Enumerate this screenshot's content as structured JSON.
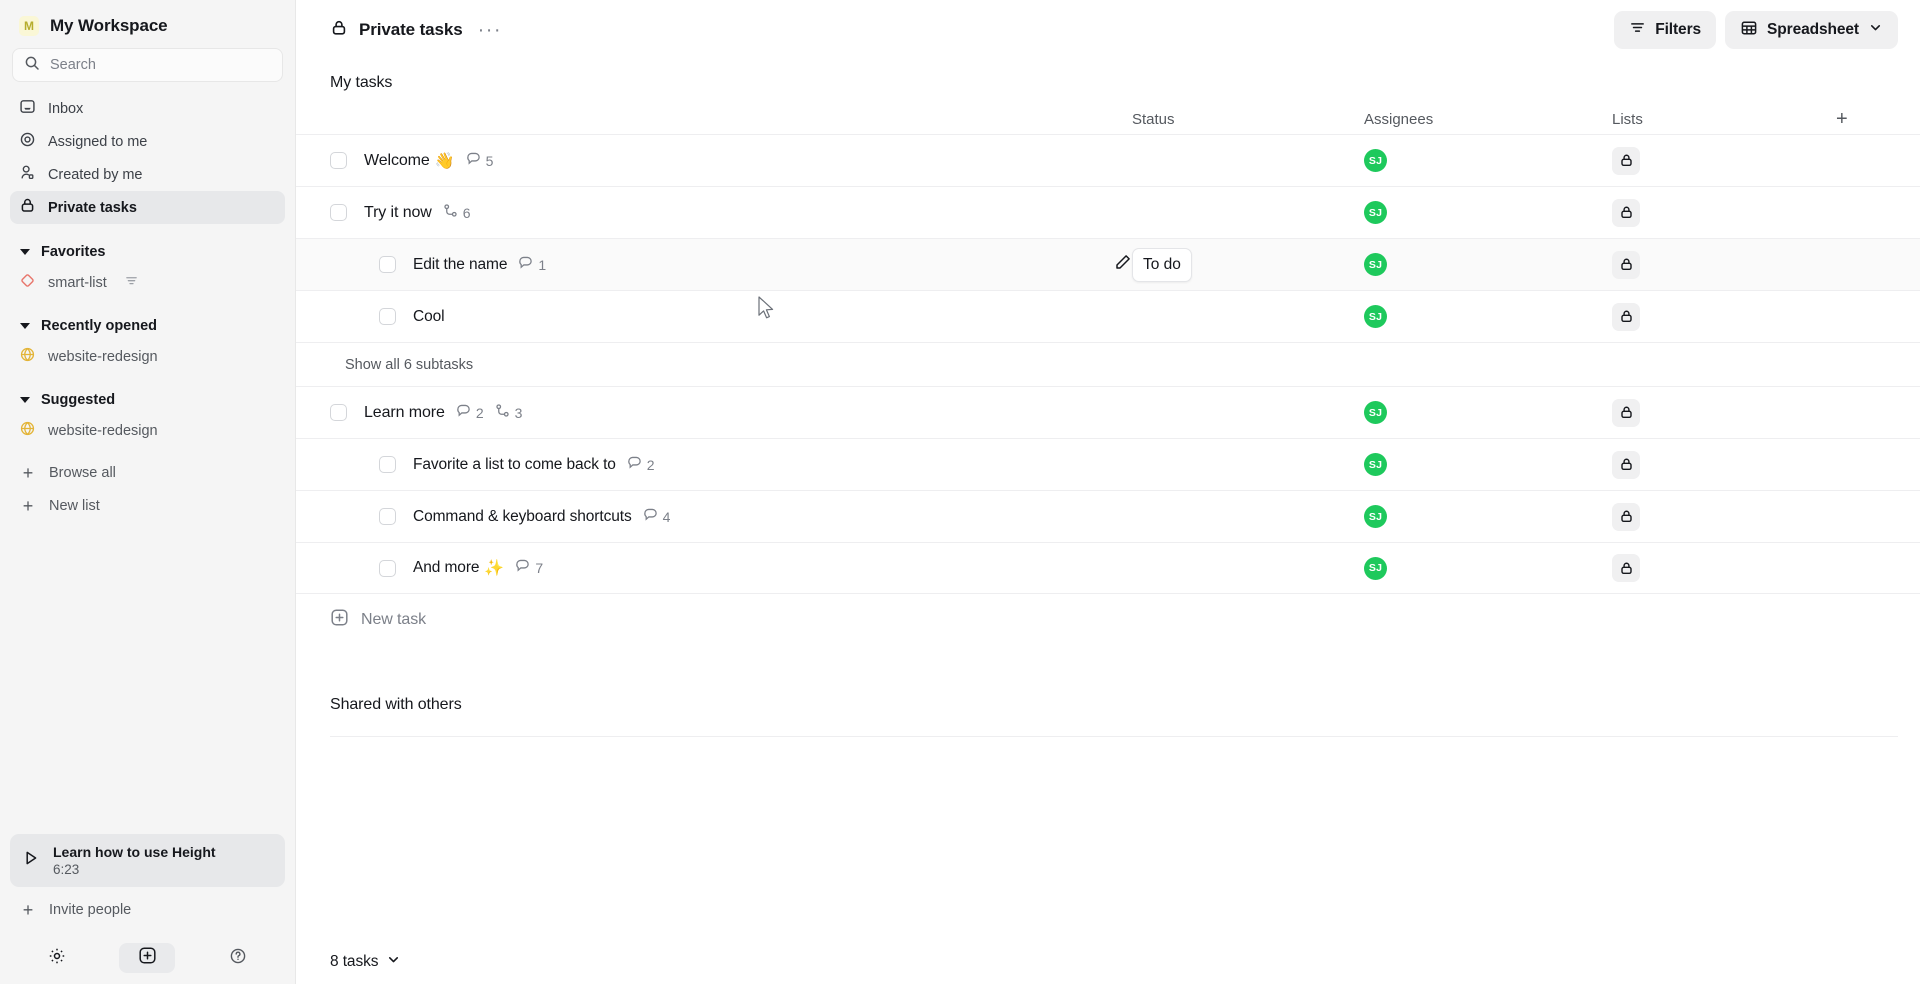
{
  "sidebar": {
    "workspace": {
      "badge": "M",
      "name": "My Workspace",
      "badge_color": "#b5ad2e"
    },
    "search": {
      "placeholder": "Search",
      "icon": "search-icon"
    },
    "nav": [
      {
        "label": "Inbox",
        "icon": "inbox-icon",
        "active": false
      },
      {
        "label": "Assigned to me",
        "icon": "target-icon",
        "active": false
      },
      {
        "label": "Created by me",
        "icon": "user-icon",
        "active": false
      },
      {
        "label": "Private tasks",
        "icon": "lock-icon",
        "active": true
      }
    ],
    "sections": [
      {
        "title": "Favorites",
        "items": [
          {
            "label": "smart-list",
            "icon": "diamond-icon",
            "icon_color": "#e8756b",
            "suffix_icon": "filter-icon"
          }
        ]
      },
      {
        "title": "Recently opened",
        "items": [
          {
            "label": "website-redesign",
            "icon": "globe-icon",
            "icon_color": "#e3b437"
          }
        ]
      },
      {
        "title": "Suggested",
        "items": [
          {
            "label": "website-redesign",
            "icon": "globe-icon",
            "icon_color": "#e3b437"
          }
        ]
      }
    ],
    "actions": [
      {
        "label": "Browse all",
        "icon": "plus-icon"
      },
      {
        "label": "New list",
        "icon": "plus-icon"
      }
    ],
    "learn_card": {
      "title": "Learn how to use Height",
      "duration": "6:23",
      "icon": "play-icon"
    },
    "invite": {
      "label": "Invite people",
      "icon": "plus-icon"
    },
    "footer": [
      {
        "name": "settings-icon",
        "label": "gear-icon"
      },
      {
        "name": "new-item-icon",
        "label": "plus-box-icon"
      },
      {
        "name": "help-icon",
        "label": "question-icon"
      }
    ]
  },
  "topbar": {
    "title": "Private tasks",
    "title_icon": "lock-icon",
    "overflow": "···",
    "filters_label": "Filters",
    "view_label": "Spreadsheet"
  },
  "table": {
    "section_title": "My tasks",
    "columns": {
      "name": "",
      "status": "Status",
      "assignees": "Assignees",
      "lists": "Lists",
      "add": "+"
    },
    "rows": [
      {
        "title": "Welcome",
        "emoji": "👋",
        "indent": 0,
        "comments": "5",
        "subtasks": null,
        "status": "",
        "assignee": "SJ",
        "list_icon": "lock-icon",
        "selected": false
      },
      {
        "title": "Try it now",
        "emoji": "",
        "indent": 0,
        "comments": null,
        "subtasks": "6",
        "status": "",
        "assignee": "SJ",
        "list_icon": "lock-icon",
        "selected": false
      },
      {
        "title": "Edit the name",
        "emoji": "",
        "indent": 1,
        "comments": "1",
        "subtasks": null,
        "status": "To do",
        "assignee": "SJ",
        "list_icon": "lock-icon",
        "selected": true
      },
      {
        "title": "Cool",
        "emoji": "",
        "indent": 1,
        "comments": null,
        "subtasks": null,
        "status": "",
        "assignee": "SJ",
        "list_icon": "lock-icon",
        "selected": false
      }
    ],
    "show_all": "Show all 6 subtasks",
    "rows2": [
      {
        "title": "Learn more",
        "emoji": "",
        "indent": 0,
        "comments": "2",
        "subtasks": "3",
        "status": "",
        "assignee": "SJ",
        "list_icon": "lock-icon",
        "selected": false
      },
      {
        "title": "Favorite a list to come back to",
        "emoji": "",
        "indent": 1,
        "comments": "2",
        "subtasks": null,
        "status": "",
        "assignee": "SJ",
        "list_icon": "lock-icon",
        "selected": false
      },
      {
        "title": "Command & keyboard shortcuts",
        "emoji": "",
        "indent": 1,
        "comments": "4",
        "subtasks": null,
        "status": "",
        "assignee": "SJ",
        "list_icon": "lock-icon",
        "selected": false
      },
      {
        "title": "And more",
        "emoji": "✨",
        "indent": 1,
        "comments": "7",
        "subtasks": null,
        "status": "",
        "assignee": "SJ",
        "list_icon": "lock-icon",
        "selected": false
      }
    ],
    "new_task": "New task",
    "shared_section": "Shared with others"
  },
  "statusbar": {
    "count_label": "8 tasks"
  },
  "colors": {
    "avatar": "#1ec95c",
    "accent_yellow": "#e3b437",
    "accent_red": "#e8756b"
  }
}
